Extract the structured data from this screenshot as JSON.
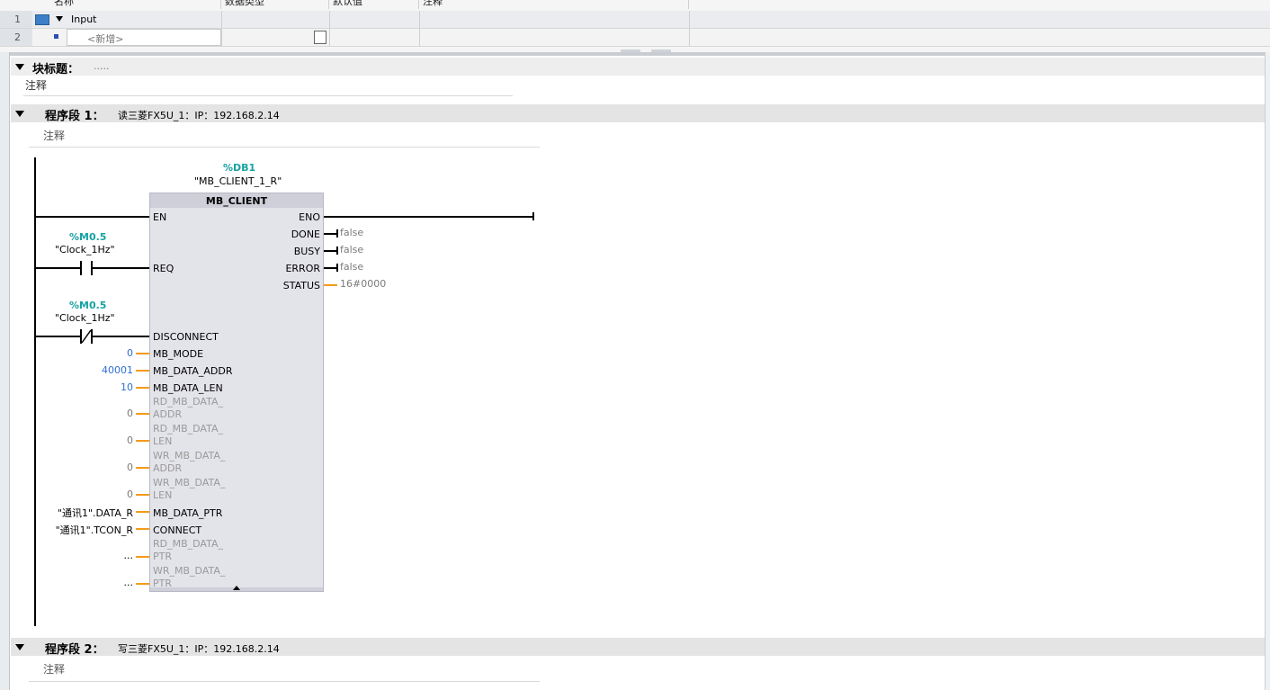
{
  "interface": {
    "headers": [
      "名称",
      "数据类型",
      "默认值",
      "注释"
    ],
    "rows": [
      {
        "num": "1",
        "name": "Input"
      },
      {
        "num": "2",
        "name": "<新增>"
      }
    ]
  },
  "block_title": {
    "label": "块标题：",
    "value": ".....",
    "comment": "注释"
  },
  "network1": {
    "label": "程序段 1：",
    "title": "读三菱FX5U_1：IP：192.168.2.14",
    "comment": "注释",
    "instance": {
      "address": "%DB1",
      "name": "\"MB_CLIENT_1_R\""
    },
    "block": {
      "name": "MB_CLIENT",
      "inputs": {
        "en": "EN",
        "req": "REQ",
        "disconnect": "DISCONNECT",
        "mb_mode": "MB_MODE",
        "mb_data_addr": "MB_DATA_ADDR",
        "mb_data_len": "MB_DATA_LEN",
        "rd_addr_1": "RD_MB_DATA_",
        "rd_addr_2": "ADDR",
        "rd_len_1": "RD_MB_DATA_",
        "rd_len_2": "LEN",
        "wr_addr_1": "WR_MB_DATA_",
        "wr_addr_2": "ADDR",
        "wr_len_1": "WR_MB_DATA_",
        "wr_len_2": "LEN",
        "mb_data_ptr": "MB_DATA_PTR",
        "connect": "CONNECT",
        "rd_ptr_1": "RD_MB_DATA_",
        "rd_ptr_2": "PTR",
        "wr_ptr_1": "WR_MB_DATA_",
        "wr_ptr_2": "PTR"
      },
      "outputs": {
        "eno": "ENO",
        "done": "DONE",
        "busy": "BUSY",
        "error": "ERROR",
        "status": "STATUS"
      }
    },
    "contact1": {
      "address": "%M0.5",
      "name": "\"Clock_1Hz\""
    },
    "contact2": {
      "address": "%M0.5",
      "name": "\"Clock_1Hz\""
    },
    "values": {
      "mb_mode": "0",
      "mb_data_addr": "40001",
      "mb_data_len": "10",
      "rd_addr": "0",
      "rd_len": "0",
      "wr_addr": "0",
      "wr_len": "0",
      "mb_data_ptr": "\"通讯1\".DATA_R",
      "connect": "\"通讯1\".TCON_R",
      "rd_ptr": "...",
      "wr_ptr": "...",
      "done": "false",
      "busy": "false",
      "error": "false",
      "status": "16#0000"
    }
  },
  "network2": {
    "label": "程序段 2：",
    "title": "写三菱FX5U_1：IP：192.168.2.14",
    "comment": "注释"
  },
  "colors": {
    "teal": "#17a2a2",
    "orange": "#f59a1a",
    "blue_value": "#2f6fd0",
    "block_fill": "#e3e3ea"
  }
}
